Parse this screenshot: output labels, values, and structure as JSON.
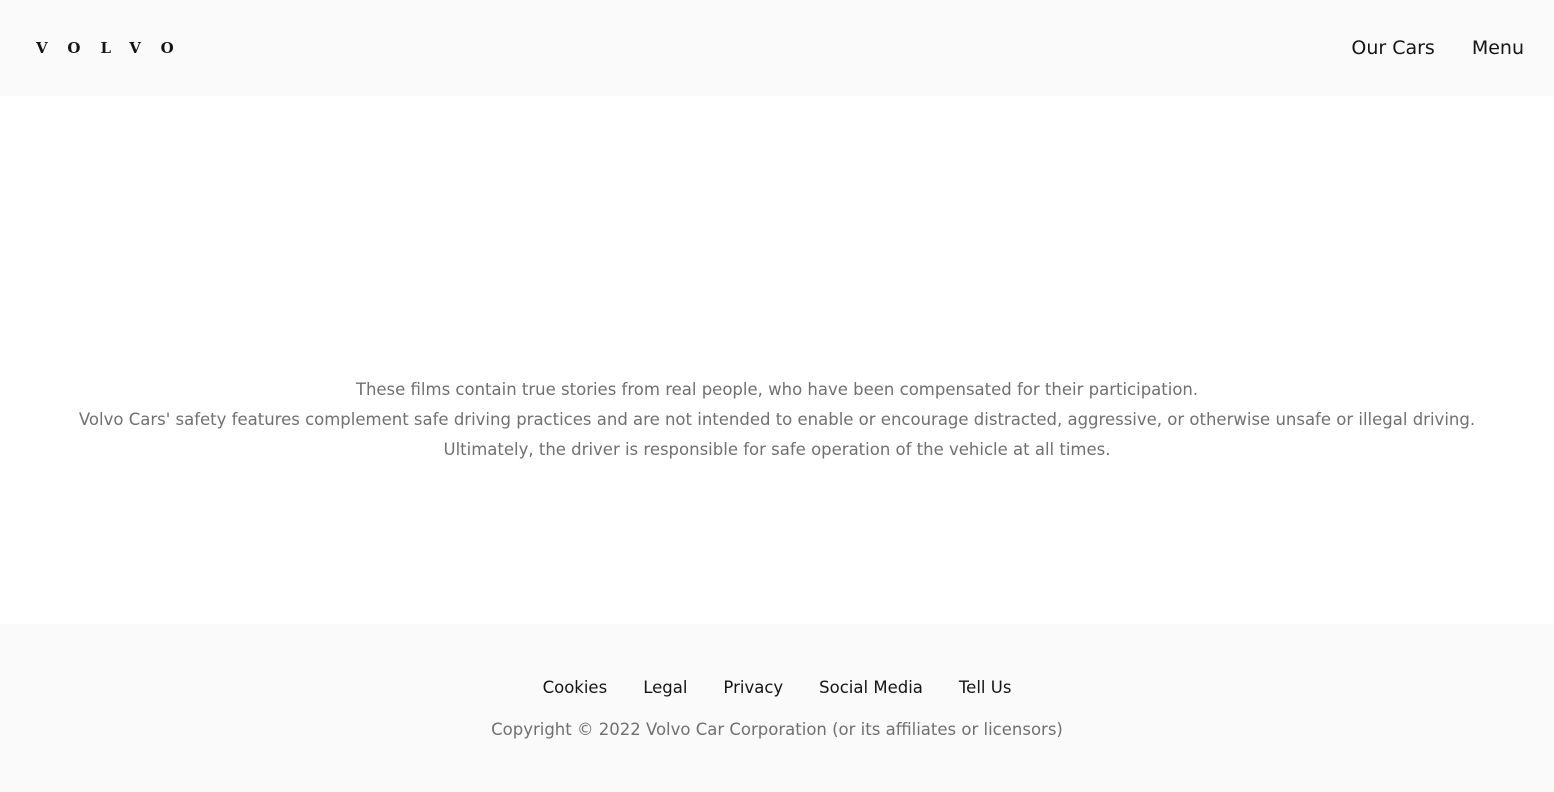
{
  "header": {
    "logo_text": "VOLVO",
    "nav": {
      "our_cars_label": "Our Cars",
      "menu_label": "Menu"
    }
  },
  "main": {
    "disclaimer_lines": [
      "These films contain true stories from real people, who have been compensated for their participation.",
      "Volvo Cars' safety features complement safe driving practices and are not intended to enable or encourage distracted, aggressive, or otherwise unsafe or illegal driving.",
      "Ultimately, the driver is responsible for safe operation of the vehicle at all times."
    ]
  },
  "footer": {
    "links": [
      "Cookies",
      "Legal",
      "Privacy",
      "Social Media",
      "Tell Us"
    ],
    "copyright": "Copyright © 2022 Volvo Car Corporation (or its affiliates or licensors)"
  },
  "colors": {
    "header_bg": "#fafafa",
    "footer_bg": "#fafafa",
    "text_primary": "#141414",
    "text_secondary": "#707070"
  }
}
